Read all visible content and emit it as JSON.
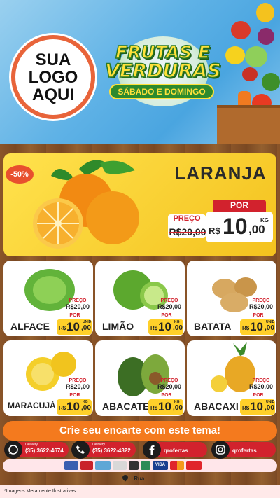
{
  "header": {
    "logo_lines": [
      "SUA",
      "LOGO",
      "AQUI"
    ],
    "title_line1": "FRUTAS E",
    "title_line2": "VERDURAS",
    "subtitle": "SÁBADO E DOMINGO"
  },
  "hero": {
    "discount": "-50%",
    "name": "LARANJA",
    "preco_label": "PREÇO",
    "old_price": "R$20,00",
    "por_label": "POR",
    "currency": "R$",
    "price_int": "10",
    "price_dec": ",00",
    "unit": "KG"
  },
  "products": [
    {
      "name": "ALFACE",
      "preco_label": "PREÇO",
      "old_price": "R$20,00",
      "por_label": "POR",
      "currency": "R$",
      "price_int": "10",
      "price_dec": ",00",
      "unit": "UNID"
    },
    {
      "name": "LIMÃO",
      "preco_label": "PREÇO",
      "old_price": "R$20,00",
      "por_label": "POR",
      "currency": "R$",
      "price_int": "10",
      "price_dec": ",00",
      "unit": "KG"
    },
    {
      "name": "BATATA",
      "preco_label": "PREÇO",
      "old_price": "R$20,00",
      "por_label": "POR",
      "currency": "R$",
      "price_int": "10",
      "price_dec": ",00",
      "unit": "UNID"
    },
    {
      "name": "MARACUJÁ",
      "preco_label": "PREÇO",
      "old_price": "R$20,00",
      "por_label": "POR",
      "currency": "R$",
      "price_int": "10",
      "price_dec": ",00",
      "unit": "KG"
    },
    {
      "name": "ABACATE",
      "preco_label": "PREÇO",
      "old_price": "R$20,00",
      "por_label": "POR",
      "currency": "R$",
      "price_int": "10",
      "price_dec": ",00",
      "unit": "KG"
    },
    {
      "name": "ABACAXI",
      "preco_label": "PREÇO",
      "old_price": "R$20,00",
      "por_label": "POR",
      "currency": "R$",
      "price_int": "10",
      "price_dec": ",00",
      "unit": "UNID"
    }
  ],
  "cta": "Crie seu encarte com este tema!",
  "contacts": [
    {
      "icon": "whatsapp-icon",
      "small": "Delivery",
      "text": "(35) 3622-4674"
    },
    {
      "icon": "phone-icon",
      "small": "Delivery",
      "text": "(35) 3622-4322"
    },
    {
      "icon": "facebook-icon",
      "small": "",
      "text": "qrofertas"
    },
    {
      "icon": "instagram-icon",
      "small": "",
      "text": "qrofertas"
    }
  ],
  "payments": [
    "",
    "",
    "",
    "",
    "",
    "",
    "VISA",
    "",
    ""
  ],
  "address": "Rua",
  "footnote": "*Imagens Meramente Ilustrativas",
  "colors": {
    "accent": "#f47a1e",
    "red": "#d2222d",
    "yellow": "#ffd02a",
    "green": "#2d8a2e"
  }
}
